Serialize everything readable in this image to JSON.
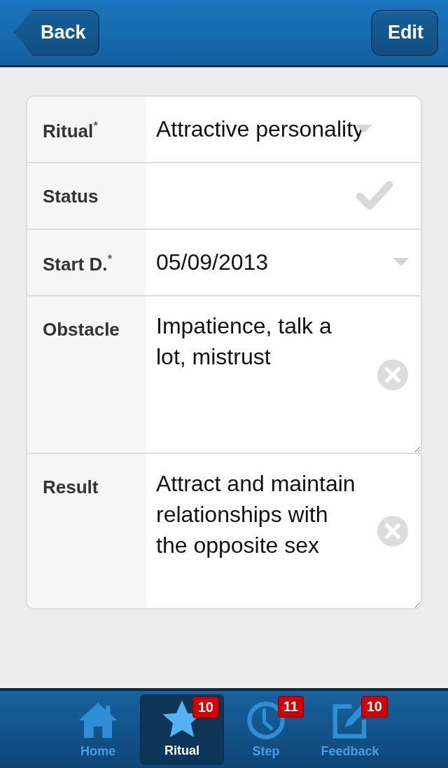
{
  "header": {
    "back": "Back",
    "edit": "Edit"
  },
  "form": [
    {
      "kind": "select",
      "label": "Ritual$^{*}$",
      "value": "Attractive personality"
    },
    {
      "kind": "check",
      "label": "Status",
      "checked": false
    },
    {
      "kind": "date",
      "label": "Start D.$^{*}$",
      "value": "05/09/2013"
    },
    {
      "kind": "textarea",
      "label": "Obstacle",
      "value": "Impatience, talk a lot, mistrust"
    },
    {
      "kind": "textarea",
      "label": "Result",
      "value": "Attract and maintain relationships with the opposite sex"
    }
  ],
  "navbar": [
    {
      "kind": "home",
      "label": "Home",
      "selected": false
    },
    {
      "kind": "star",
      "label": "Ritual",
      "selected": true,
      "badge": "10"
    },
    {
      "kind": "clock",
      "label": "Step",
      "selected": false,
      "badge": "11"
    },
    {
      "kind": "edit",
      "label": "Feedback",
      "selected": false,
      "badge": "10"
    }
  ]
}
